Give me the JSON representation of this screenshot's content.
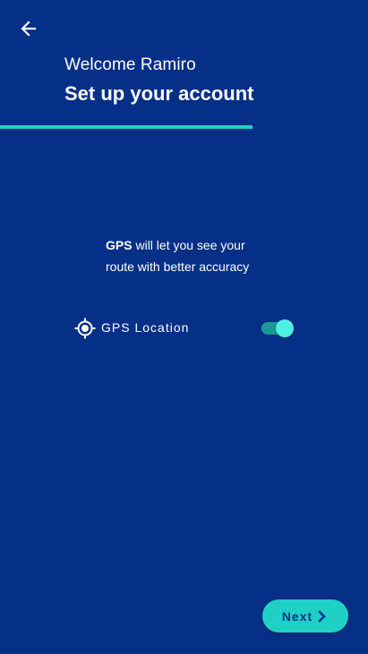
{
  "header": {
    "back_icon": "arrow-left-icon",
    "welcome_text": "Welcome Ramiro",
    "title": "Set up your account"
  },
  "progress": {
    "fraction": 0.686
  },
  "gps_info": {
    "bold_text": "GPS",
    "rest_text": " will let you see your route with better accuracy"
  },
  "gps_setting": {
    "icon": "gps-target-icon",
    "label": "GPS Location",
    "enabled": true
  },
  "footer": {
    "next_label": "Next",
    "next_icon": "chevron-right-icon"
  },
  "colors": {
    "background": "#063088",
    "accent": "#1fd1c4",
    "toggle_thumb": "#4ef0e4",
    "toggle_track": "#1a9a92"
  }
}
